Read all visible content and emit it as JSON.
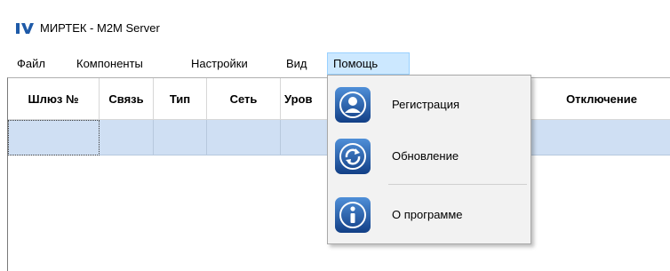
{
  "window": {
    "title": "МИРТЕК - M2M Server"
  },
  "menu": {
    "items": [
      {
        "label": "Файл"
      },
      {
        "label": "Компоненты"
      },
      {
        "label": "Настройки"
      },
      {
        "label": "Вид"
      },
      {
        "label": "Помощь"
      }
    ]
  },
  "table": {
    "columns": [
      "Шлюз №",
      "Связь",
      "Тип",
      "Сеть",
      "Уров",
      "Отключение"
    ],
    "selected_row": [
      "",
      "",
      "",
      "",
      ""
    ]
  },
  "help_menu": {
    "items": [
      {
        "label": "Регистрация",
        "icon": "user-icon"
      },
      {
        "label": "Обновление",
        "icon": "refresh-icon"
      },
      {
        "label": "О программе",
        "icon": "info-icon"
      }
    ]
  },
  "colors": {
    "accent": "#1e5aa8",
    "selection": "#cfdff3",
    "menu_highlight": "#cce8ff"
  }
}
